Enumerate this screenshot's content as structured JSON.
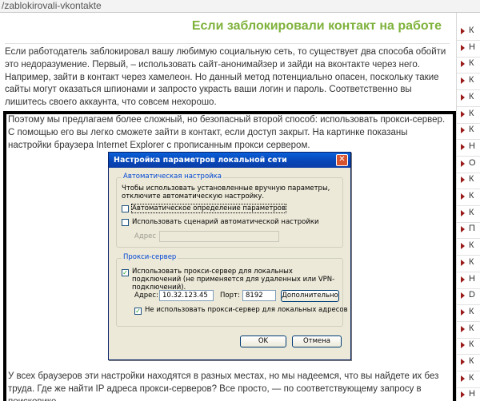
{
  "address_bar": {
    "url": "/zablokirovali-vkontakte"
  },
  "article": {
    "title": "Если заблокировали контакт на работе",
    "paragraph1": "Если работодатель заблокировал вашу любимую социальную сеть, то существует два способа обойти это недоразумение. Первый, – использовать сайт-анонимайзер и зайди на вконтакте через него. Например, зайти в контакт через хамелеон. Но данный метод потенциально опасен, поскольку такие сайты могут оказаться шпионами и запросто украсть ваши логин и пароль. Соответственно вы лишитесь своего аккаунта, что совсем нехорошо.",
    "paragraph2": "Поэтому мы предлагаем более сложный, но безопасный второй способ: использовать прокси-сервер. С помощью его вы легко сможете зайти в контакт, если доступ закрыт. На картинке показаны настройки браузера Internet Explorer с прописанным прокси сервером.",
    "paragraph3": "У всех браузеров эти настройки находятся в разных местах, но мы надеемся, что вы найдете их без труда. Где же найти IP адреса прокси-серверов? Все просто, — по соответствующему запросу в поисковике."
  },
  "dialog": {
    "title": "Настройка параметров локальной сети",
    "close_glyph": "✕",
    "auto_group_label": "Автоматическая настройка",
    "auto_description": "Чтобы использовать установленные вручную параметры, отключите автоматическую настройку.",
    "auto_detect_label": "Автоматическое определение параметров",
    "auto_detect_checked": false,
    "auto_script_label": "Использовать сценарий автоматической настройки",
    "auto_script_checked": false,
    "auto_address_label": "Адрес",
    "auto_address_value": "",
    "proxy_group_label": "Прокси-сервер",
    "use_proxy_label": "Использовать прокси-сервер для локальных подключений (не применяется для удаленных или VPN-подключений).",
    "use_proxy_checked": true,
    "proxy_address_label": "Адрес:",
    "proxy_address_value": "10.32.123.45",
    "proxy_port_label": "Порт:",
    "proxy_port_value": "8192",
    "advanced_button": "Дополнительно",
    "bypass_local_label": "Не использовать прокси-сервер для локальных адресов",
    "bypass_local_checked": true,
    "ok_button": "OK",
    "cancel_button": "Отмена",
    "check_glyph": "✓"
  },
  "sidebar": {
    "items": [
      "К",
      "Н",
      "К",
      "К",
      "К",
      "К",
      "К",
      "Н",
      "О",
      "К",
      "К",
      "К",
      "П",
      "К",
      "К",
      "Н",
      "D",
      "К",
      "К",
      "К",
      "К",
      "К",
      "Н"
    ]
  },
  "colors": {
    "title_green": "#7fb23c",
    "bullet_red": "#9b1b1b",
    "dialog_title_blue": "#0a4fc8",
    "dialog_face": "#ece9d8"
  }
}
